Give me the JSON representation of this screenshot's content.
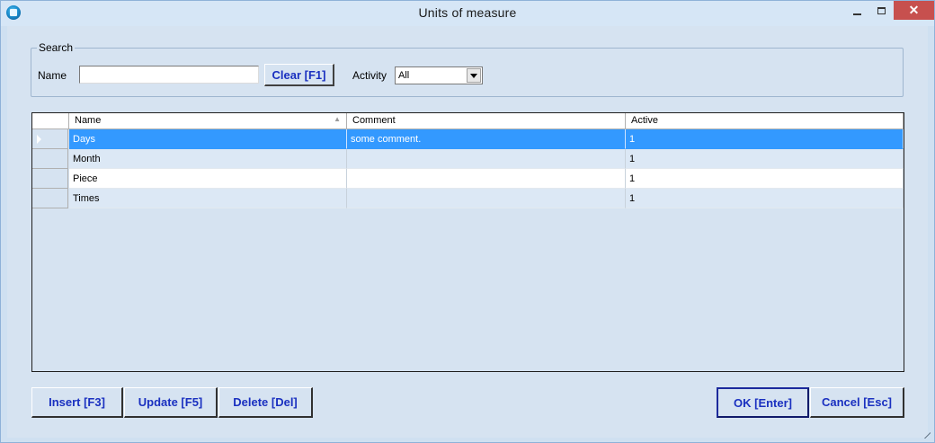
{
  "window": {
    "title": "Units of measure",
    "close_glyph": "✕"
  },
  "search": {
    "legend": "Search",
    "name_label": "Name",
    "name_value": "",
    "clear_label": "Clear [F1]",
    "activity_label": "Activity",
    "activity_value": "All"
  },
  "grid": {
    "columns": [
      "Name",
      "Comment",
      "Active"
    ],
    "sorted_column": "Name",
    "rows": [
      {
        "name": "Days",
        "comment": "some comment.",
        "active": "1"
      },
      {
        "name": "Month",
        "comment": "",
        "active": "1"
      },
      {
        "name": "Piece",
        "comment": "",
        "active": "1"
      },
      {
        "name": "Times",
        "comment": "",
        "active": "1"
      }
    ],
    "selected_row": 0
  },
  "buttons": {
    "insert": "Insert [F3]",
    "update": "Update [F5]",
    "delete": "Delete [Del]",
    "ok": "OK [Enter]",
    "cancel": "Cancel [Esc]"
  },
  "colors": {
    "accent_text": "#1a30c0",
    "selection": "#3399ff",
    "close_button": "#c7504e"
  },
  "icons": {
    "app": "app-icon",
    "minimize": "minimize-icon",
    "maximize": "maximize-icon",
    "close": "close-icon",
    "sort": "sort-ascending-icon",
    "dropdown": "chevron-down-icon",
    "row_pointer": "row-pointer-icon",
    "resize_grip": "resize-grip-icon"
  }
}
